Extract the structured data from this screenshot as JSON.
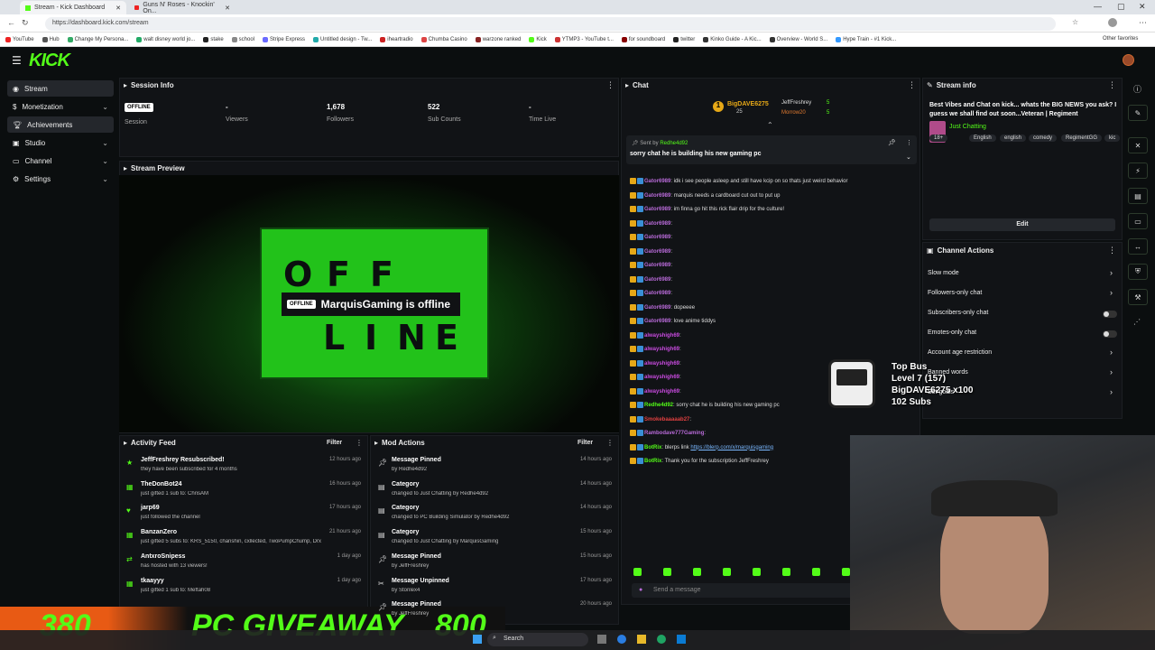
{
  "browser": {
    "tabs": [
      {
        "label": "Stream - Kick Dashboard"
      },
      {
        "label": "Guns N' Roses - Knockin' On..."
      }
    ],
    "url": "https://dashboard.kick.com/stream",
    "new_tab": "+",
    "bookmarks": [
      "YouTube",
      "Hub",
      "Change My Persona...",
      "walt disney world jo...",
      "stake",
      "school",
      "Stripe Express",
      "Untitled design - Tw...",
      "iheartradio",
      "Chumba Casino",
      "warzone ranked",
      "Kick",
      "YTMP3 - YouTube t...",
      "for soundboard",
      "twitter",
      "Kinko Guide - A Kic...",
      "Overview - World S...",
      "Hype Train - #1 Kick..."
    ],
    "other_favorites": "Other favorites"
  },
  "header": {
    "logo": "KICK",
    "menu_icon": "☰"
  },
  "sidebar": {
    "items": [
      {
        "label": "Stream"
      },
      {
        "label": "Monetization"
      },
      {
        "label": "Achievements"
      },
      {
        "label": "Studio"
      },
      {
        "label": "Channel"
      },
      {
        "label": "Settings"
      }
    ]
  },
  "session": {
    "title": "Session Info",
    "status": "OFFLINE",
    "session_label": "Session",
    "viewers_value": "-",
    "viewers_label": "Viewers",
    "followers_value": "1,678",
    "followers_label": "Followers",
    "subs_value": "522",
    "subs_label": "Sub Counts",
    "time_value": "-",
    "time_label": "Time Live"
  },
  "preview": {
    "title": "Stream Preview",
    "offline_badge": "OFFLINE",
    "offline_text": "MarquisGaming is offline",
    "letters": [
      "O",
      "F",
      "F",
      "L",
      "I",
      "N",
      "E"
    ]
  },
  "activity": {
    "title": "Activity Feed",
    "filter": "Filter",
    "items": [
      {
        "title": "JeffFreshrey Resubscribed!",
        "sub": "they have been subscribed for 4 months",
        "time": "12 hours ago"
      },
      {
        "title": "TheDonBot24",
        "sub": "just gifted 1 sub to: ChrisAM",
        "time": "16 hours ago"
      },
      {
        "title": "jarp69",
        "sub": "just followed the channel",
        "time": "17 hours ago"
      },
      {
        "title": "BanzanZero",
        "sub": "just gifted 5 subs to: KRS_5150, chanshin, cxllected, TwoPumpChump, DrxppyTuff",
        "time": "21 hours ago"
      },
      {
        "title": "AntxroSnipess",
        "sub": "has hosted with 13 viewers!",
        "time": "1 day ago"
      },
      {
        "title": "tkaayyy",
        "sub": "just gifted 1 sub to: Meftah08",
        "time": "1 day ago"
      }
    ]
  },
  "mod": {
    "title": "Mod Actions",
    "filter": "Filter",
    "items": [
      {
        "title": "Message Pinned",
        "sub": "by Redhe4d92",
        "time": "14 hours ago"
      },
      {
        "title": "Category",
        "sub": "changed to Just Chatting by Redhe4d92",
        "time": "14 hours ago"
      },
      {
        "title": "Category",
        "sub": "changed to PC Building Simulator by Redhe4d92",
        "time": "14 hours ago"
      },
      {
        "title": "Category",
        "sub": "changed to Just Chatting by MarquisGaming",
        "time": "15 hours ago"
      },
      {
        "title": "Message Pinned",
        "sub": "by JeffFreshrey",
        "time": "15 hours ago"
      },
      {
        "title": "Message Unpinned",
        "sub": "by Stonlex4",
        "time": "17 hours ago"
      },
      {
        "title": "Message Pinned",
        "sub": "by JeffFreshrey",
        "time": "20 hours ago"
      }
    ]
  },
  "chat": {
    "title": "Chat",
    "top_gifter": "BigDAVE6275",
    "top_gifter_count": "25",
    "gifter2": "JeffFreshrey",
    "gifter2_count": "5",
    "gifter3": "Morrow20",
    "gifter3_count": "5",
    "pinned_by": "Sent by",
    "pinned_user": "Redhe4d92",
    "pinned_text": "sorry chat he is building his new gaming pc",
    "messages": [
      {
        "user": "Gator6989",
        "text": "idk i see people asleep and still have kcip on so thats just weird behavior"
      },
      {
        "user": "Gator6989",
        "text": "marquis needs a cardboard cut out to put up"
      },
      {
        "user": "Gator6989",
        "text": "im finna go hit this rick flair drip for the culture!"
      },
      {
        "user": "Gator6989",
        "text": ""
      },
      {
        "user": "Gator6989",
        "text": ""
      },
      {
        "user": "Gator6989",
        "text": ""
      },
      {
        "user": "Gator6989",
        "text": ""
      },
      {
        "user": "Gator6989",
        "text": ""
      },
      {
        "user": "Gator6989",
        "text": ""
      },
      {
        "user": "Gator6989",
        "text": "dopeeee"
      },
      {
        "user": "Gator6989",
        "text": "love anime tiddys"
      },
      {
        "user": "alwayshigh69",
        "text": ""
      },
      {
        "user": "alwayshigh69",
        "text": ""
      },
      {
        "user": "alwayshigh69",
        "text": ""
      },
      {
        "user": "alwayshigh69",
        "text": ""
      },
      {
        "user": "alwayshigh69",
        "text": ""
      },
      {
        "user": "Redhe4d92",
        "text": "sorry chat he is building his new gaming pc"
      },
      {
        "user": "Smokebaaaaab27",
        "text": ""
      },
      {
        "user": "Rambodave777Gaming",
        "text": ""
      },
      {
        "user": "BotRix",
        "text": "blerps link",
        "link": "https://blerp.com/x/marquisgaming"
      },
      {
        "user": "BotRix",
        "text": "Thank you for the subscription JeffFreshrey"
      }
    ],
    "placeholder": "Send a message"
  },
  "stream_info": {
    "title": "Stream info",
    "desc": "Best Vibes and Chat on kick... whats the BIG NEWS you ask? I guess we shall find out soon...Veteran | Regiment",
    "category": "Just Chatting",
    "tags": [
      "18+",
      "English",
      "english",
      "comedy",
      "RegimentGG",
      "kic"
    ],
    "edit": "Edit"
  },
  "channel_actions": {
    "title": "Channel Actions",
    "items": [
      "Slow mode",
      "Followers-only chat",
      "Subscribers-only chat",
      "Emotes-only chat",
      "Account age restriction",
      "Banned words",
      "Set goals"
    ]
  },
  "overlay": {
    "topbus_title": "Top Bus",
    "topbus_level": "Level 7 (157)",
    "topbus_user": "BigDAVE6275 x100",
    "topbus_subs": "102 Subs",
    "banner_left": "380",
    "banner_mid": "PC GIVEAWAY",
    "banner_right": "800"
  },
  "taskbar": {
    "search": "Search"
  }
}
